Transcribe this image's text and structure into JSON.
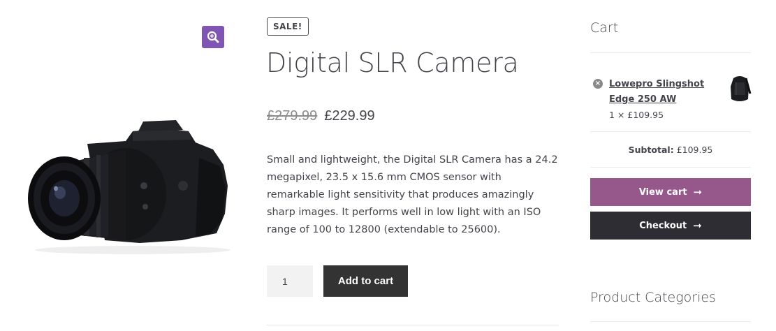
{
  "product": {
    "sale_badge": "SALE!",
    "title": "Digital SLR Camera",
    "price_old": "£279.99",
    "price_new": "£229.99",
    "description": "Small and lightweight, the Digital SLR Camera has a 24.2 megapixel, 23.5 x 15.6 mm CMOS sensor with remarkable light sensitivity that produces amazingly sharp images. It performs well in low light with an ISO range of 100 to 12800 (extendable to 25600).",
    "quantity": "1",
    "add_to_cart_label": "Add to cart"
  },
  "gallery": {
    "zoom_icon": "magnify-plus-icon",
    "image": "camera"
  },
  "cart_widget": {
    "title": "Cart",
    "item": {
      "remove_icon": "remove-x-circle-icon",
      "name": "Lowepro Slingshot Edge 250 AW",
      "qty_price": "1 × £109.95",
      "image": "backpack"
    },
    "subtotal_label": "Subtotal:",
    "subtotal_value": "£109.95",
    "view_cart_label": "View cart",
    "checkout_label": "Checkout",
    "arrow_icon": "arrow-right-icon"
  },
  "categories_widget": {
    "title": "Product Categories"
  },
  "colors": {
    "accent_purple": "#96588a",
    "zoom_purple": "#7f54b3",
    "dark_button": "#333333",
    "text": "#43454b"
  }
}
